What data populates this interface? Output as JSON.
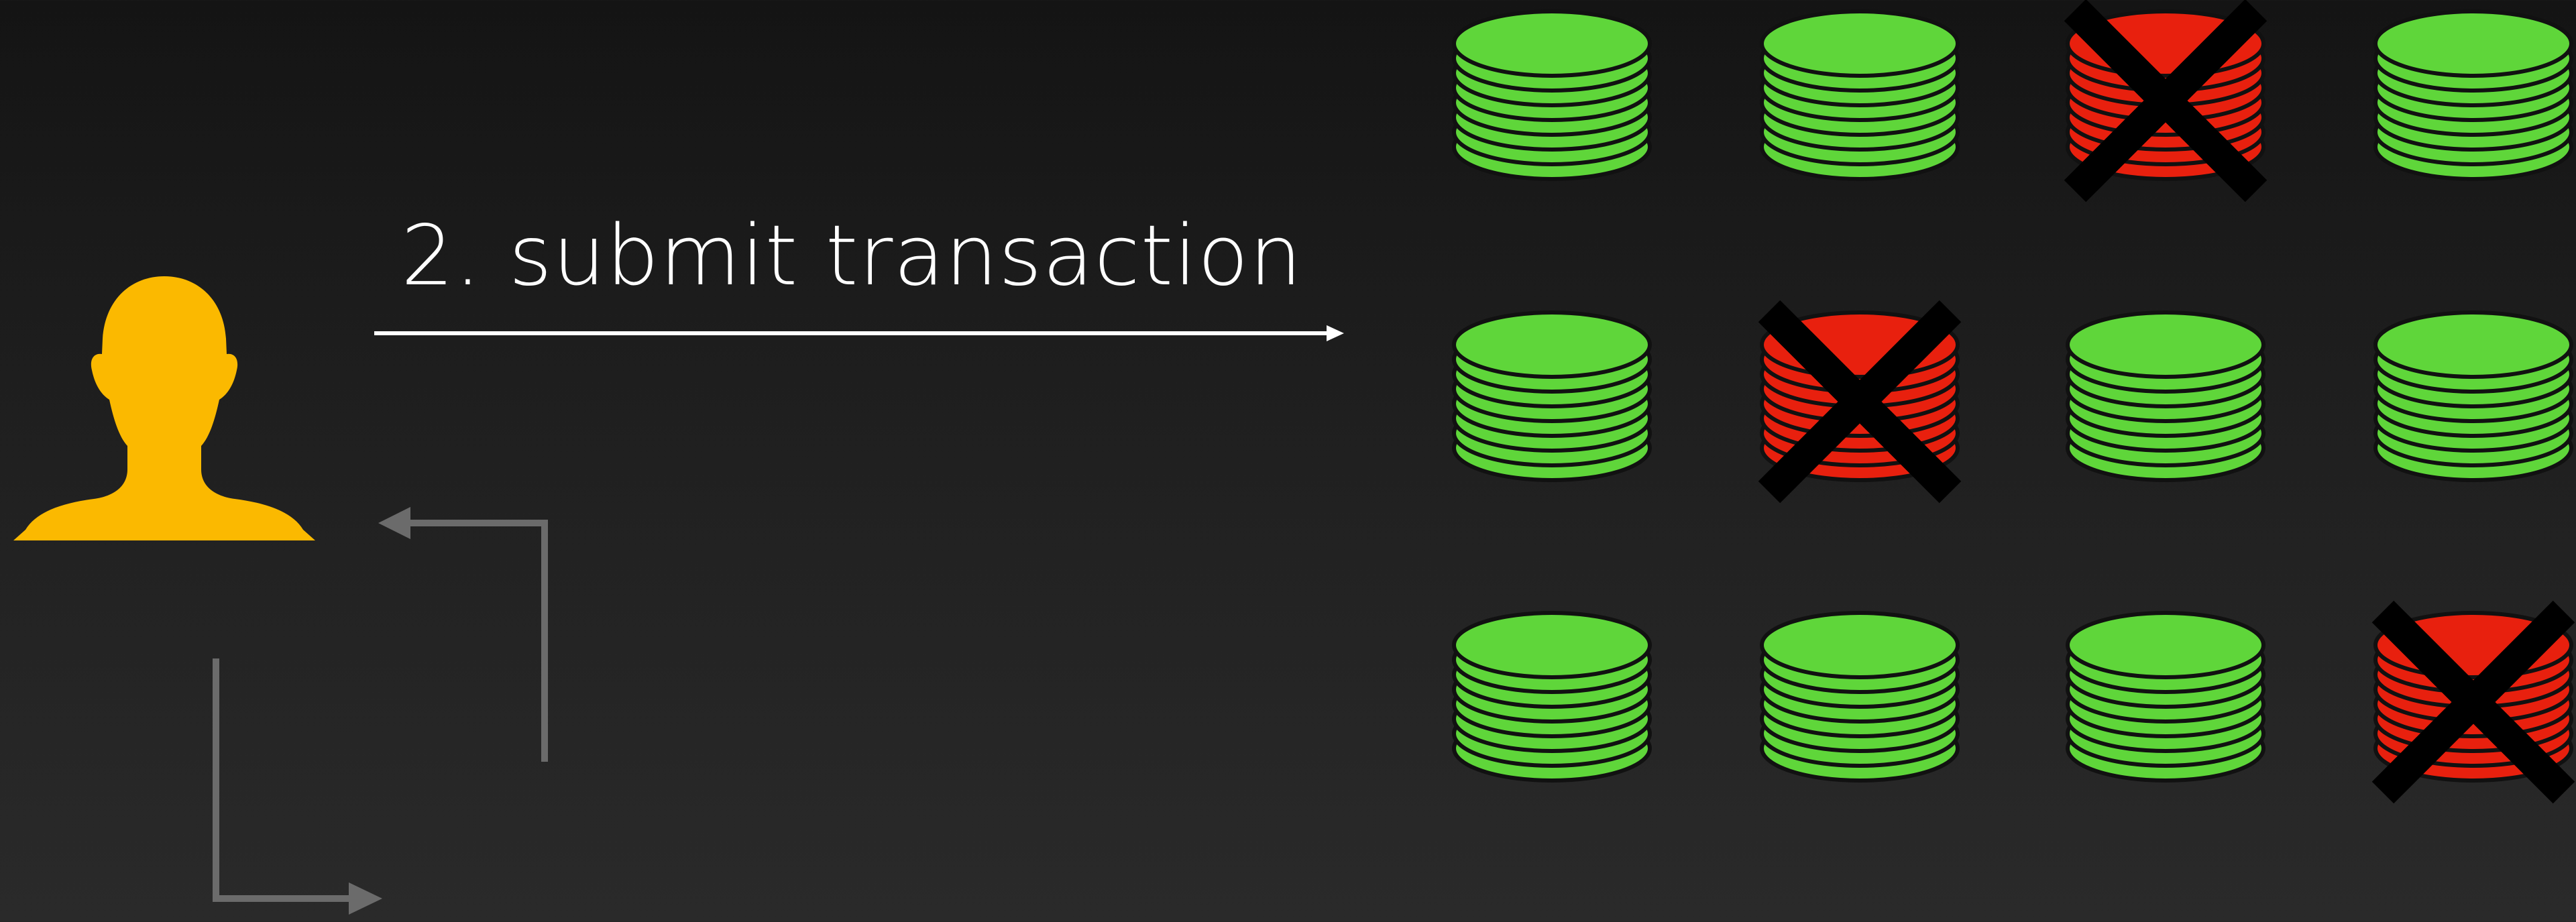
{
  "step_label": "2. submit transaction",
  "colors": {
    "background_top": "#141414",
    "background_bottom": "#2a2a2a",
    "user": "#fbb900",
    "node_ok": "#5fd63a",
    "node_failed": "#e8200e",
    "node_outline": "#111111",
    "failure_mark": "#000000",
    "arrow_primary": "#ffffff",
    "arrow_secondary": "#6b6b6b"
  },
  "user": {
    "icon": "user-silhouette-icon"
  },
  "nodes": [
    {
      "row": 1,
      "col": 1,
      "status": "ok"
    },
    {
      "row": 1,
      "col": 2,
      "status": "ok"
    },
    {
      "row": 1,
      "col": 3,
      "status": "failed"
    },
    {
      "row": 1,
      "col": 4,
      "status": "ok"
    },
    {
      "row": 2,
      "col": 1,
      "status": "ok"
    },
    {
      "row": 2,
      "col": 2,
      "status": "failed"
    },
    {
      "row": 2,
      "col": 3,
      "status": "ok"
    },
    {
      "row": 2,
      "col": 4,
      "status": "ok"
    },
    {
      "row": 3,
      "col": 1,
      "status": "ok"
    },
    {
      "row": 3,
      "col": 2,
      "status": "ok"
    },
    {
      "row": 3,
      "col": 3,
      "status": "ok"
    },
    {
      "row": 3,
      "col": 4,
      "status": "failed"
    }
  ]
}
